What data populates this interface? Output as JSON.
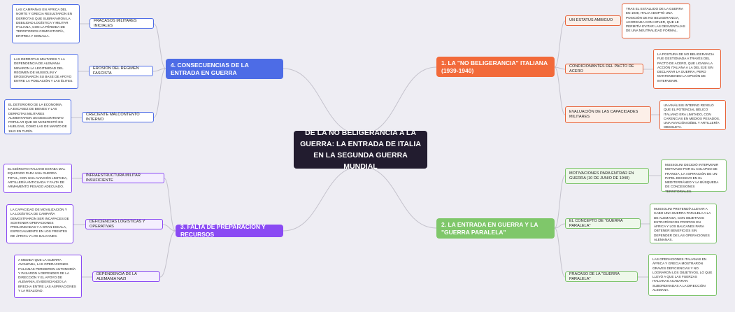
{
  "title": "DE LA NO BELIGERANCIA A LA GUERRA: LA ENTRADA DE ITALIA EN LA SEGUNDA GUERRA MUNDIAL",
  "colors": {
    "b1": "#f26a3a",
    "b2": "#7fc76a",
    "b3": "#8a4af3",
    "b4": "#4d6ce6",
    "line": "#c4c2cc",
    "center": "#221c2f"
  },
  "branches": [
    {
      "label": "1. LA \"NO BELIGERANCIA\" ITALIANA (1939-1940)",
      "children": [
        {
          "label": "UN ESTATUS AMBIGUO",
          "note": "TRAS EL ESTALLIDO DE LA GUERRA EN 1939, ITALIA ADOPTÓ UNA POSICIÓN DE NO BELIGERANCIA, ACORDADA CON HITLER, QUE LE PERMITÍA EVITAR LAS DESVENTAJAS DE UNA NEUTRALIDAD FORMAL."
        },
        {
          "label": "CONDICIONANTES DEL PACTO DE ACERO",
          "note": "LA POSTURA DE NO BELIGERANCIA FUE GESTIONADA A TRAVÉS DEL PACTO DE ACERO, QUE LIGABA LA ACCIÓN ITALIANA A LA DEL EJE SIN DECLARAR LA GUERRA, PERO MANTENIENDO LA OPCIÓN DE INTERVENIR."
        },
        {
          "label": "EVALUACIÓN DE LAS CAPACIDADES MILITARES",
          "note": "UN ANÁLISIS INTERNO REVELÓ QUE EL POTENCIAL BÉLICO ITALIANO ERA LIMITADO, CON CARENCIAS EN MEDIOS PESADOS, UNA AVIACIÓN DÉBIL Y ARTILLERÍA OBSOLETA."
        }
      ]
    },
    {
      "label": "2. LA ENTRADA EN GUERRA Y LA \"GUERRA PARALELA\"",
      "children": [
        {
          "label": "MOTIVACIONES PARA ENTRAR EN GUERRA (10 DE JUNIO DE 1940)",
          "note": "MUSSOLINI DECIDIÓ INTERVENIR MOTIVADO POR EL COLAPSO DE FRANCIA, LA ASPIRACIÓN DE UN PAPEL DECISIVO EN EL MEDITERRÁNEO Y LA BÚSQUEDA DE CONCESIONES TERRITORIALES."
        },
        {
          "label": "EL CONCEPTO DE \"GUERRA PARALELA\"",
          "note": "MUSSOLINI PRETENDÍA LLEVAR A CABO UNA GUERRA PARALELA A LA DE ALEMANIA, CON OBJETIVOS ESTRATÉGICOS PROPIOS EN ÁFRICA Y LOS BALCANES PARA OBTENER BENEFICIOS SIN DEPENDER DE LAS OPERACIONES ALEMANAS."
        },
        {
          "label": "FRACASO DE LA \"GUERRA PARALELA\"",
          "note": "LAS OPERACIONES ITALIANAS EN ÁFRICA Y GRECIA MOSTRARON GRAVES DEFICIENCIAS Y NO LOGRARON LOS OBJETIVOS, LO QUE LLEVÓ A QUE LAS FUERZAS ITALIANAS ACABARAN SUBORDINADAS A LA DIRECCIÓN ALEMANA."
        }
      ]
    },
    {
      "label": "3. FALTA DE PREPARACIÓN Y RECURSOS",
      "children": [
        {
          "label": "INFRAESTRUCTURA MILITAR INSUFICIENTE",
          "note": "EL EJÉRCITO ITALIANO ESTABA MAL EQUIPADO PARA UNA GUERRA TOTAL, CON UNA AVIACIÓN LIMITADA, ARTILLERÍA ANTICUADA Y FALTA DE ARMAMENTO PESADO ADECUADO."
        },
        {
          "label": "DEFICIENCIAS LOGÍSTICAS Y OPERATIVAS",
          "note": "LA CAPACIDAD DE MOVILIZACIÓN Y LA LOGÍSTICA DE CAMPAÑA DEMOSTRARON SER INCAPACES DE SOSTENER OPERACIONES PROLONGADAS Y A GRAN ESCALA, ESPECIALMENTE EN LOS FRENTES DE ÁFRICA Y LOS BALCANES."
        },
        {
          "label": "DEPENDENCIA DE LA ALEMANIA NAZI",
          "note": "A MEDIDA QUE LA GUERRA AVANZABA, LAS OPERACIONES ITALIANAS PERDIERON AUTONOMÍA Y PASARON A DEPENDER DE LA DIRECCIÓN Y EL APOYO DE ALEMANIA, EVIDENCIANDO LA BRECHA ENTRE LAS ASPIRACIONES Y LA REALIDAD."
        }
      ]
    },
    {
      "label": "4. CONSECUENCIAS DE LA ENTRADA EN GUERRA",
      "children": [
        {
          "label": "FRACASOS MILITARES INICIALES",
          "note": "LAS CAMPAÑAS EN ÁFRICA DEL NORTE Y GRECIA RESULTARON EN DERROTAS QUE SUBRAYARON LA DEBILIDAD LOGÍSTICA Y MILITAR ITALIANA, CON LA PÉRDIDA DE TERRITORIOS COMO ETIOPÍA, ERITREA Y SOMALIA."
        },
        {
          "label": "EROSIÓN DEL RÉGIMEN FASCISTA",
          "note": "LAS DERROTAS MILITARES Y LA DEPENDENCIA DE ALEMANIA MINARON LA LEGITIMIDAD DEL RÉGIMEN DE MUSSOLINI Y EROSIONARON SU BASE DE APOYO ENTRE LA POBLACIÓN Y LAS ÉLITES."
        },
        {
          "label": "CRECIENTE MALCONTENTO INTERNO",
          "note": "EL DETERIORO DE LA ECONOMÍA, LA ESCASEZ DE BIENES Y LAS DERROTAS MILITARES ALIMENTARON UN DESCONTENTO POPULAR QUE SE MANIFESTÓ EN HUELGAS, COMO LAS DE MARZO DE 1943 EN TURÍN."
        }
      ]
    }
  ]
}
